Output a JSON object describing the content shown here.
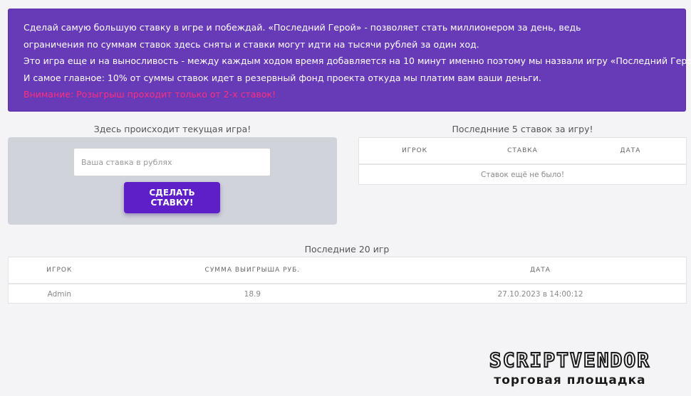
{
  "banner": {
    "line1": "Сделай самую большую ставку в игре и побеждай. «Последний Герой» - позволяет стать миллионером за день, ведь",
    "line2": "ограничения по суммам ставок здесь сняты и ставки могут идти на тысячи рублей за один ход.",
    "line3": "Это игра еще и на выносливость - между каждым ходом время добавляется на 10 минут именно поэтому мы назвали игру «Последний Герой».",
    "line4": "И самое главное: 10% от суммы ставок идет в резервный фонд проекта откуда мы платим вам ваши деньги.",
    "warning": "Внимание: Розыгрыш проходит только от 2-х ставок!"
  },
  "game": {
    "title": "Здесь происходит текущая игра!",
    "input_placeholder": "Ваша ставка в рублях",
    "button_label": "СДЕЛАТЬ СТАВКУ!"
  },
  "last_bets": {
    "title": "Последнние 5 ставок за игру!",
    "columns": [
      "ИГРОК",
      "СТАВКА",
      "ДАТА"
    ],
    "empty_message": "Ставок ещё не было!"
  },
  "last_games": {
    "title": "Последние 20 игр",
    "columns": [
      "ИГРОК",
      "СУММА ВЫИГРЫША РУБ.",
      "ДАТА"
    ],
    "rows": [
      {
        "player": "Admin",
        "amount": "18.9",
        "date": "27.10.2023 в 14:00:12"
      }
    ]
  },
  "watermark": {
    "main": "SCRIPTVENDOR",
    "sub": "торговая площадка"
  },
  "colors": {
    "banner_bg": "#673ab7",
    "warning": "#ff2f7d",
    "button_bg": "#5e1fc9"
  }
}
